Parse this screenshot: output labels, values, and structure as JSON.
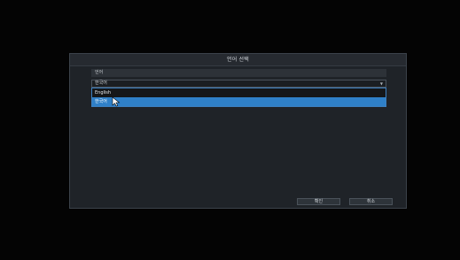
{
  "dialog": {
    "title": "언어 선택",
    "section_label": "언어",
    "select": {
      "value": "한국어"
    },
    "dropdown_options": [
      {
        "label": "English",
        "selected": false
      },
      {
        "label": "한국어",
        "selected": true
      }
    ],
    "buttons": {
      "ok_label": "확인",
      "cancel_label": "취소"
    }
  },
  "icons": {
    "dropdown_arrow": "chevron-down-icon",
    "cursor": "mouse-pointer-icon"
  },
  "colors": {
    "selection_blue": "#2f80c8",
    "dialog_bg": "#1f2328"
  }
}
